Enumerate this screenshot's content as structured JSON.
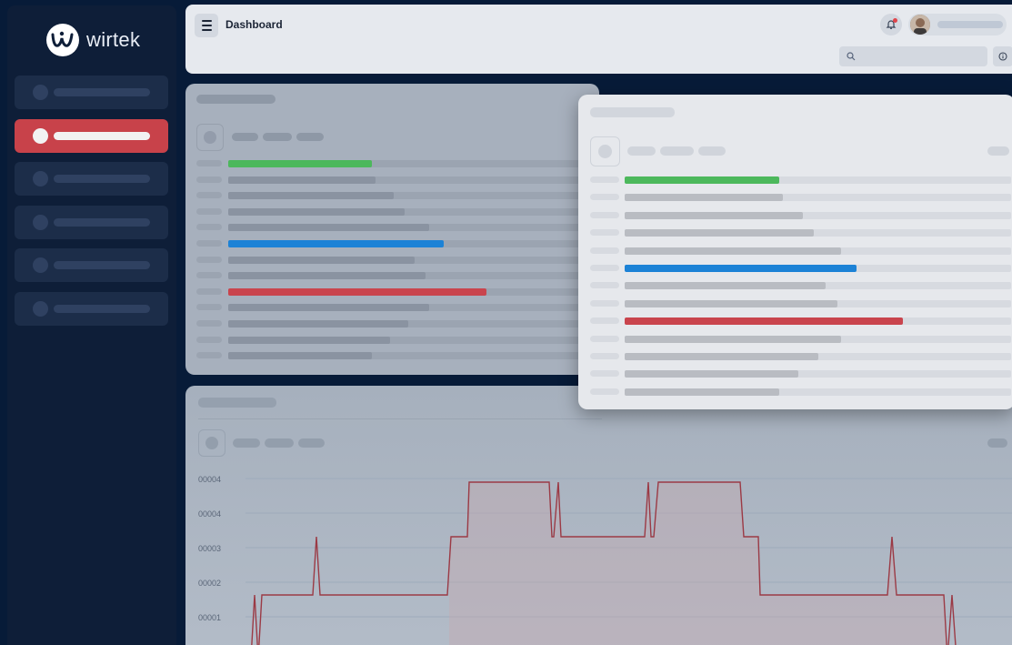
{
  "brand": {
    "name": "wirtek"
  },
  "header": {
    "title": "Dashboard"
  },
  "sidebar": {
    "items": [
      {
        "active": false
      },
      {
        "active": true
      },
      {
        "active": false
      },
      {
        "active": false
      },
      {
        "active": false
      },
      {
        "active": false
      }
    ]
  },
  "colors": {
    "accent_red": "#c8424a",
    "bar_green": "#4cb85c",
    "bar_blue": "#1c82d6",
    "bar_red": "#c9444d",
    "line": "#9b3a45"
  },
  "icons": [
    "menu-icon",
    "bell-icon",
    "avatar",
    "search-icon",
    "info-icon"
  ],
  "chart": {
    "y_labels": [
      "00004",
      "00004",
      "00003",
      "00002",
      "00001"
    ]
  }
}
